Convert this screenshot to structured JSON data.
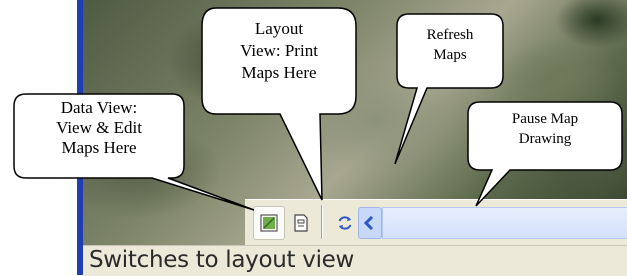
{
  "toolbar": {
    "buttons": [
      {
        "name": "data-view",
        "icon": "data-view-icon",
        "pressed": true
      },
      {
        "name": "layout-view",
        "icon": "layout-view-icon",
        "pressed": false
      },
      {
        "name": "refresh",
        "icon": "refresh-icon",
        "pressed": false
      },
      {
        "name": "pause",
        "icon": "pause-icon",
        "pressed": false
      }
    ],
    "scroll_left_icon": "chevron-left-icon"
  },
  "status_bar": {
    "text": "Switches to layout view"
  },
  "callouts": {
    "data_view": {
      "lines": [
        "Data View:",
        "View & Edit",
        "Maps Here"
      ]
    },
    "layout_view": {
      "lines": [
        "Layout",
        "View: Print",
        "Maps Here"
      ]
    },
    "refresh": {
      "lines": [
        "Refresh",
        "Maps"
      ]
    },
    "pause": {
      "lines": [
        "Pause Map",
        "Drawing"
      ]
    }
  },
  "colors": {
    "window_edge": "#1f3fb0",
    "toolbar_bg": "#ece9d8",
    "icon_blue": "#2b58c5",
    "scroll_blue": "#c8d8f8"
  }
}
